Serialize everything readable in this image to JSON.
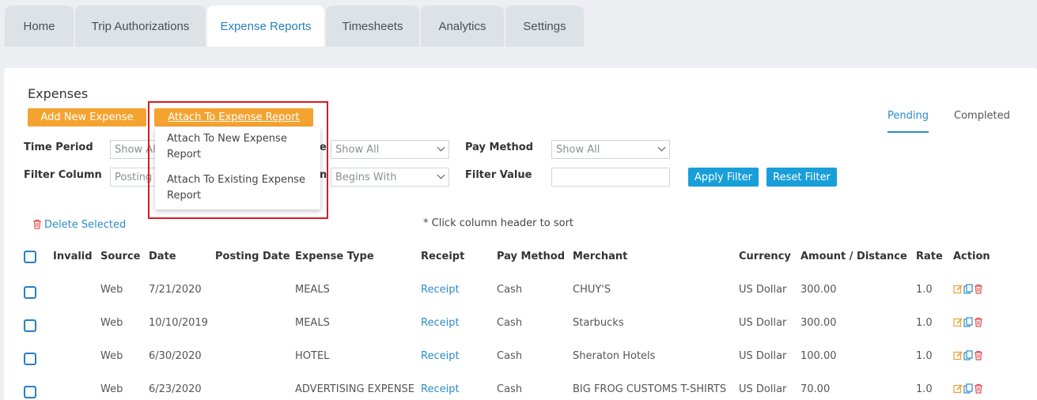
{
  "tabs": [
    "Home",
    "Trip Authorizations",
    "Expense Reports",
    "Timesheets",
    "Analytics",
    "Settings"
  ],
  "page_title": "Expenses",
  "buttons": {
    "add_new_expense": "Add New Expense",
    "attach_to_report": "Attach To Expense Report",
    "apply_filter": "Apply Filter",
    "reset_filter": "Reset Filter"
  },
  "dropdown_menu": {
    "items": [
      "Attach To New Expense Report",
      "Attach To Existing Expense Report"
    ]
  },
  "view_tabs": {
    "pending": "Pending",
    "completed": "Completed",
    "active": "pending"
  },
  "filters": {
    "time_period_label": "Time Period",
    "time_period_value": "Show Al",
    "hidden_label_fragment": "e",
    "second_select_value": "Show All",
    "pay_method_label": "Pay Method",
    "pay_method_value": "Show All",
    "filter_column_label": "Filter Column",
    "filter_column_value": "Posting",
    "hidden_label_fragment2": "n",
    "condition_value": "Begins With",
    "filter_value_label": "Filter Value",
    "filter_value": ""
  },
  "delete_selected": "Delete Selected",
  "sort_hint": "* Click column header to sort",
  "table": {
    "headers": [
      "Invalid",
      "Source",
      "Date",
      "Posting Date",
      "Expense Type",
      "Receipt",
      "Pay Method",
      "Merchant",
      "Currency",
      "Amount / Distance",
      "Rate",
      "Action"
    ],
    "rows": [
      {
        "invalid": "",
        "source": "Web",
        "date": "7/21/2020",
        "posting_date": "",
        "expense_type": "MEALS",
        "receipt": "Receipt",
        "pay_method": "Cash",
        "merchant": "CHUY'S",
        "currency": "US Dollar",
        "amount": "300.00",
        "rate": "1.0"
      },
      {
        "invalid": "",
        "source": "Web",
        "date": "10/10/2019",
        "posting_date": "",
        "expense_type": "MEALS",
        "receipt": "Receipt",
        "pay_method": "Cash",
        "merchant": "Starbucks",
        "currency": "US Dollar",
        "amount": "300.00",
        "rate": "1.0"
      },
      {
        "invalid": "",
        "source": "Web",
        "date": "6/30/2020",
        "posting_date": "",
        "expense_type": "HOTEL",
        "receipt": "Receipt",
        "pay_method": "Cash",
        "merchant": "Sheraton Hotels",
        "currency": "US Dollar",
        "amount": "100.00",
        "rate": "1.0"
      },
      {
        "invalid": "",
        "source": "Web",
        "date": "6/23/2020",
        "posting_date": "",
        "expense_type": "ADVERTISING EXPENSE",
        "receipt": "Receipt",
        "pay_method": "Cash",
        "merchant": "BIG FROG CUSTOMS T-SHIRTS",
        "currency": "US Dollar",
        "amount": "70.00",
        "rate": "1.0"
      }
    ]
  },
  "colors": {
    "accent_orange": "#f5a330",
    "accent_blue": "#189fd9",
    "link_blue": "#2a8bc8",
    "highlight_red": "#d81b22"
  }
}
